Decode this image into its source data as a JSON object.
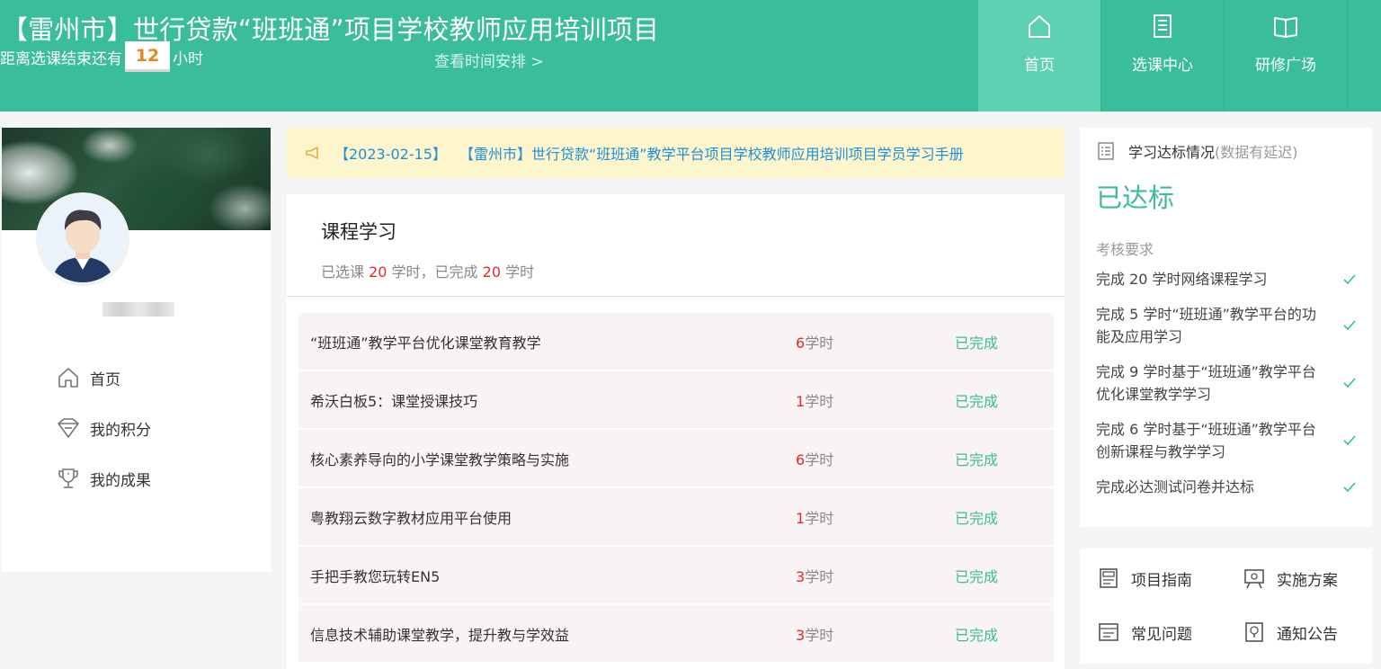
{
  "header": {
    "title": "【雷州市】世行贷款“班班通”项目学校教师应用培训项目",
    "countdown_prefix": "距离选课结束还有",
    "countdown_value": "12",
    "countdown_unit": "小时",
    "schedule_link": "查看时间安排 >"
  },
  "nav": {
    "items": [
      {
        "label": "首页",
        "icon": "home-icon",
        "active": true
      },
      {
        "label": "选课中心",
        "icon": "book-list-icon",
        "active": false
      },
      {
        "label": "研修广场",
        "icon": "open-book-icon",
        "active": false
      }
    ]
  },
  "sidebar": {
    "items": [
      {
        "label": "首页",
        "icon": "home-outline-icon"
      },
      {
        "label": "我的积分",
        "icon": "points-gem-icon"
      },
      {
        "label": "我的成果",
        "icon": "trophy-icon"
      }
    ]
  },
  "notice": {
    "icon": "megaphone-icon",
    "date": "【2023-02-15】",
    "text": "【雷州市】世行贷款“班班通”教学平台项目学校教师应用培训项目学员学习手册"
  },
  "course": {
    "title": "课程学习",
    "summary": {
      "selected_prefix": "已选课 ",
      "selected_value": "20",
      "selected_suffix": " 学时，已完成 ",
      "completed_value": "20",
      "completed_suffix": " 学时"
    },
    "hours_unit": "学时",
    "rows": [
      {
        "name": "“班班通”教学平台优化课堂教育教学",
        "hours": "6",
        "status": "已完成"
      },
      {
        "name": "希沃白板5：课堂授课技巧",
        "hours": "1",
        "status": "已完成"
      },
      {
        "name": "核心素养导向的小学课堂教学策略与实施",
        "hours": "6",
        "status": "已完成"
      },
      {
        "name": "粤教翔云数字教材应用平台使用",
        "hours": "1",
        "status": "已完成"
      },
      {
        "name": "手把手教您玩转EN5",
        "hours": "3",
        "status": "已完成"
      },
      {
        "name": "信息技术辅助课堂教学，提升教与学效益",
        "hours": "3",
        "status": "已完成"
      }
    ]
  },
  "standard": {
    "heading": "学习达标情况",
    "heading_note": "(数据有延迟)",
    "state": "已达标",
    "requirements_label": "考核要求",
    "requirements": [
      "完成 20 学时网络课程学习",
      "完成 5 学时“班班通”教学平台的功能及应用学习",
      "完成 9 学时基于“班班通”教学平台优化课堂教学学习",
      "完成 6 学时基于“班班通”教学平台创新课程与教学学习",
      "完成必达测试问卷并达标"
    ]
  },
  "resources": {
    "items": [
      {
        "label": "项目指南",
        "icon": "guide-icon"
      },
      {
        "label": "实施方案",
        "icon": "plan-icon"
      },
      {
        "label": "常见问题",
        "icon": "faq-icon"
      },
      {
        "label": "通知公告",
        "icon": "announcement-icon"
      }
    ]
  },
  "colors": {
    "brand": "#39bd9b",
    "nav_active": "#5fd1b3",
    "highlight_red": "#e02b2b",
    "notice_bg": "#fdf6cd",
    "notice_text": "#1e8fd6",
    "countdown_orange": "#e9851c"
  }
}
